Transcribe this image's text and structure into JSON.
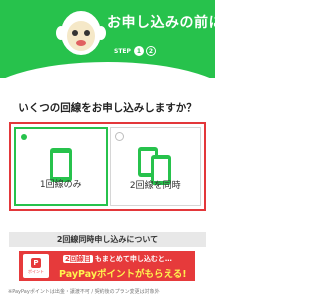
{
  "header": {
    "title": "お申し込みの前に",
    "step_label": "STEP",
    "steps": [
      "1",
      "2"
    ],
    "bg_color": "#27c24c"
  },
  "question": "いくつの回線をお申し込みしますか？",
  "options": [
    {
      "label": "1回線のみ",
      "icon": "single-phone-icon",
      "selected": true
    },
    {
      "label": "2回線を同時",
      "icon": "two-phones-icon",
      "selected": false
    }
  ],
  "info": {
    "title": "2回線同時申し込みについて"
  },
  "banner": {
    "chip": "2回線目",
    "line1": "もまとめて申し込むと…",
    "line2": "PayPayポイントがもらえる!",
    "logo_text": "ポイント",
    "bg_color": "#e63a3b"
  },
  "footnote": "※PayPayポイントは出金・譲渡不可 / 契約後のプラン変更は対象外",
  "colors": {
    "accent": "#27c24c",
    "highlight": "#e3373a"
  }
}
